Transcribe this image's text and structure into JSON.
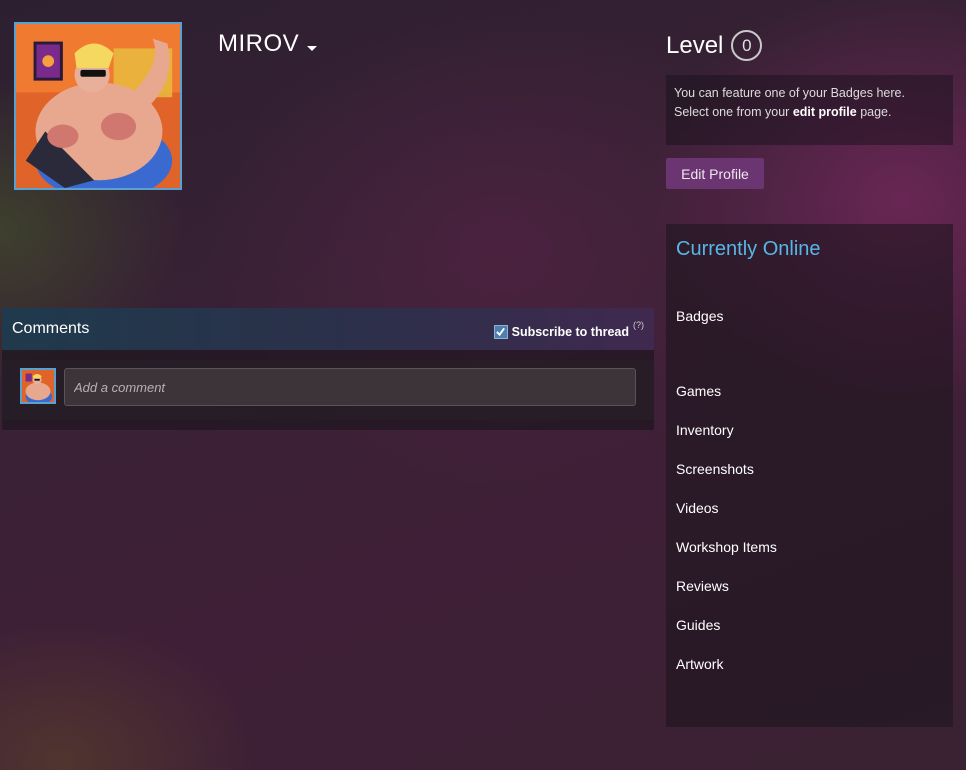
{
  "profile": {
    "persona_name": "MIROV",
    "avatar_icon": "avatar-image"
  },
  "level": {
    "label": "Level",
    "value": "0"
  },
  "badge_showcase": {
    "line1": "You can feature one of your Badges here.",
    "line2_prefix": "Select one from your ",
    "line2_link": "edit profile",
    "line2_suffix": " page."
  },
  "edit_profile_button": "Edit Profile",
  "status": "Currently Online",
  "nav": {
    "badges": "Badges",
    "games": "Games",
    "inventory": "Inventory",
    "screenshots": "Screenshots",
    "videos": "Videos",
    "workshop_items": "Workshop Items",
    "reviews": "Reviews",
    "guides": "Guides",
    "artwork": "Artwork"
  },
  "comments": {
    "title": "Comments",
    "subscribe_label": "Subscribe to thread",
    "subscribe_checked": true,
    "help_label": "(?)",
    "input_placeholder": "Add a comment"
  },
  "colors": {
    "accent_blue": "#57b6e6",
    "button_purple": "#6a3570",
    "avatar_border": "#5aa0d0"
  }
}
